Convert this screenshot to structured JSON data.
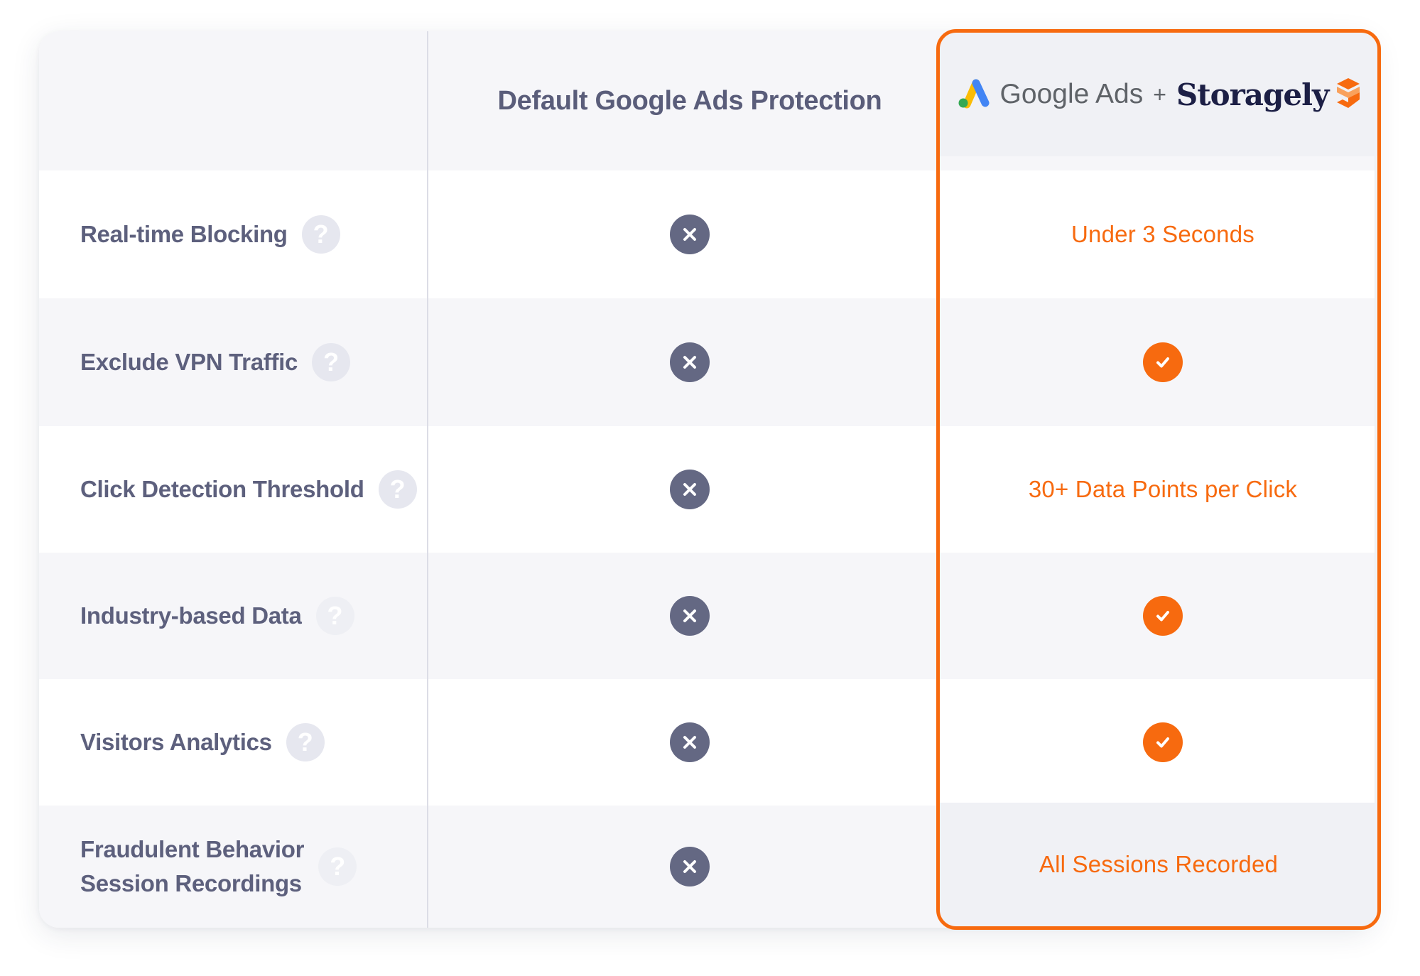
{
  "header": {
    "default_column_title": "Default Google Ads Protection",
    "brand": {
      "google_ads_label": "Google Ads",
      "plus": "+",
      "storagely_label": "Storagely"
    }
  },
  "colors": {
    "accent_orange": "#f76a0f",
    "icon_gray": "#646883",
    "label_gray": "#5d607d",
    "help_icon_bg": "#e6e7ef",
    "alt_row_bg": "#f6f6f9"
  },
  "rows": [
    {
      "feature": "Real-time Blocking",
      "help": "?",
      "default": "x-icon",
      "storagely": "Under 3 Seconds"
    },
    {
      "feature": "Exclude VPN Traffic",
      "help": "?",
      "default": "x-icon",
      "storagely": "check-icon"
    },
    {
      "feature": "Click Detection Threshold",
      "help": "?",
      "default": "x-icon",
      "storagely": "30+ Data Points per Click"
    },
    {
      "feature": "Industry-based Data",
      "help": "?",
      "default": "x-icon",
      "storagely": "check-icon"
    },
    {
      "feature": "Visitors Analytics",
      "help": "?",
      "default": "x-icon",
      "storagely": "check-icon"
    },
    {
      "feature_line1": "Fraudulent Behavior",
      "feature_line2": "Session Recordings",
      "help": "?",
      "default": "x-icon",
      "storagely": "All Sessions Recorded"
    }
  ]
}
